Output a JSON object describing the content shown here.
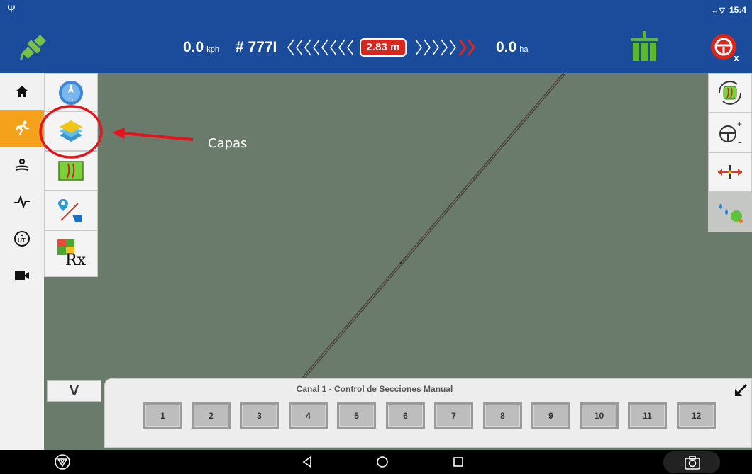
{
  "status_bar": {
    "time": "15:4"
  },
  "header": {
    "speed_value": "0.0",
    "speed_unit": "kph",
    "swath_label": "# 777I",
    "offset": "2.83 m",
    "area_value": "0.0",
    "area_unit": "ha"
  },
  "left_nav": {
    "items": [
      {
        "icon": "home-icon"
      },
      {
        "icon": "run-icon",
        "active": true
      },
      {
        "icon": "field-settings-icon"
      },
      {
        "icon": "pulse-icon"
      },
      {
        "icon": "ut-icon"
      },
      {
        "icon": "camera-icon"
      }
    ]
  },
  "tool_palette": [
    "compass-icon",
    "layers-icon",
    "guidance-lines-icon",
    "map-pin-edit-icon",
    "prescription-icon"
  ],
  "tools": {
    "rx_label": "Rx"
  },
  "annotation": {
    "label": "Capas"
  },
  "sections": {
    "toggle_label": "V",
    "title": "Canal 1 - Control de Secciones Manual",
    "buttons": [
      "1",
      "2",
      "3",
      "4",
      "5",
      "6",
      "7",
      "8",
      "9",
      "10",
      "11",
      "12"
    ]
  },
  "colors": {
    "header_bg": "#1b4c9c",
    "accent": "#f4a21b",
    "map_bg": "#6b7b6b",
    "alert": "#d9261c"
  }
}
